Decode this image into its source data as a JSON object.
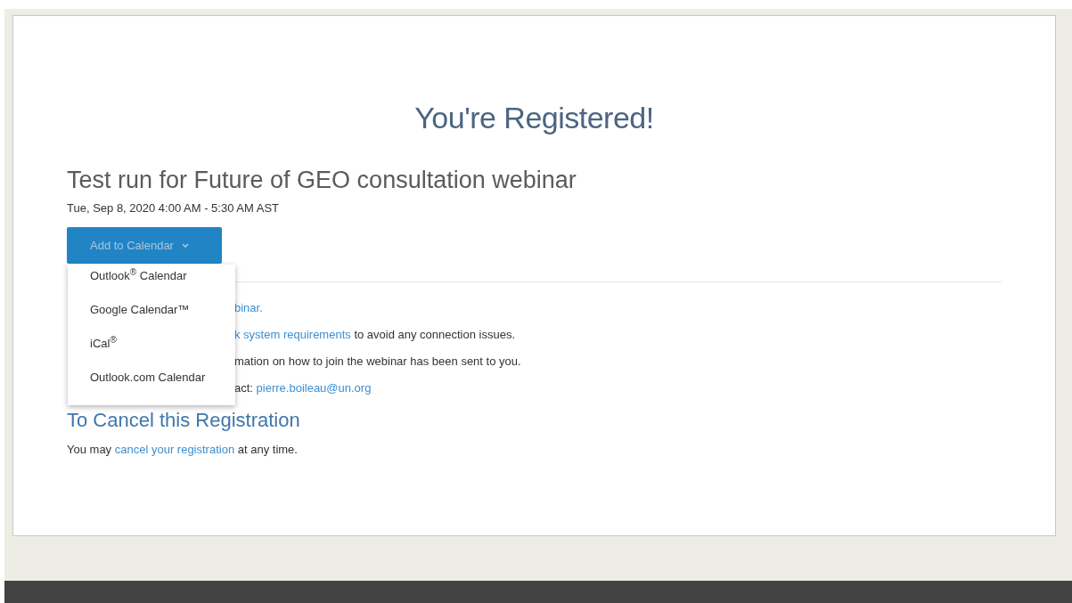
{
  "heading": "You're Registered!",
  "event": {
    "title": "Test run for Future of GEO consultation webinar",
    "datetime": "Tue, Sep 8, 2020 4:00 AM - 5:30 AM AST"
  },
  "calendar_button": {
    "label": "Add to Calendar",
    "expanded": true
  },
  "calendar_menu": [
    {
      "label": "Outlook$^{®}$ Calendar"
    },
    {
      "label": "Google Calendar™"
    },
    {
      "label": "iCal$^{®}$"
    },
    {
      "label": "Outlook.com Calendar"
    }
  ],
  "info_lines": [
    [
      {
        "kind": "link",
        "text": "binar."
      }
    ],
    [
      {
        "kind": "link",
        "text": "k system requirements"
      },
      {
        "kind": "text",
        "text": " to avoid any connection issues."
      }
    ],
    [
      {
        "kind": "text",
        "text": "mation on how to join the webinar has been sent to you."
      }
    ],
    [
      {
        "kind": "text",
        "text": "act: "
      },
      {
        "kind": "link",
        "text": "pierre.boileau@un.org"
      }
    ]
  ],
  "cancel": {
    "heading": "To Cancel this Registration",
    "text": [
      {
        "kind": "text",
        "text": "You may "
      },
      {
        "kind": "link",
        "text": "cancel your registration"
      },
      {
        "kind": "text",
        "text": " at any time."
      }
    ]
  }
}
